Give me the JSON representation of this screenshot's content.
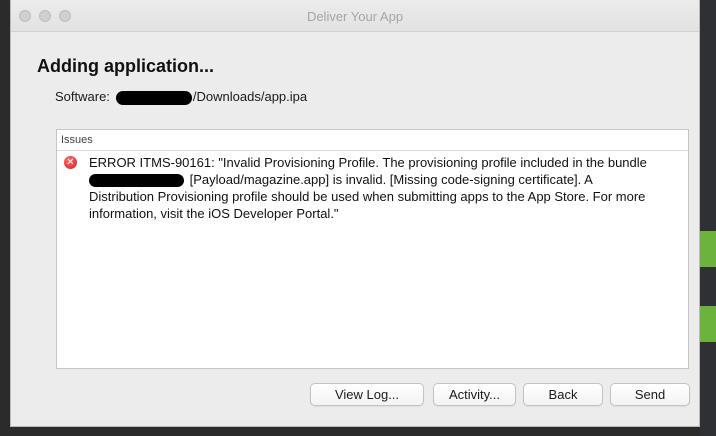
{
  "window": {
    "title": "Deliver Your App"
  },
  "main": {
    "heading": "Adding application...",
    "software_label": "Software:",
    "software_path_suffix": "/Downloads/app.ipa"
  },
  "issues": {
    "header": "Issues",
    "items": [
      {
        "line1": "ERROR ITMS-90161: \"Invalid Provisioning Profile. The provisioning profile included in the bundle",
        "line2_after_redaction": "[Payload/magazine.app] is invalid. [Missing code-signing certificate]. A",
        "line3": "Distribution Provisioning profile should be used when submitting apps to the App Store. For more",
        "line4": "information, visit the iOS Developer Portal.\""
      }
    ]
  },
  "buttons": {
    "view_log": "View Log...",
    "activity": "Activity...",
    "back": "Back",
    "send": "Send"
  },
  "icons": {
    "error_glyph": "✕"
  }
}
